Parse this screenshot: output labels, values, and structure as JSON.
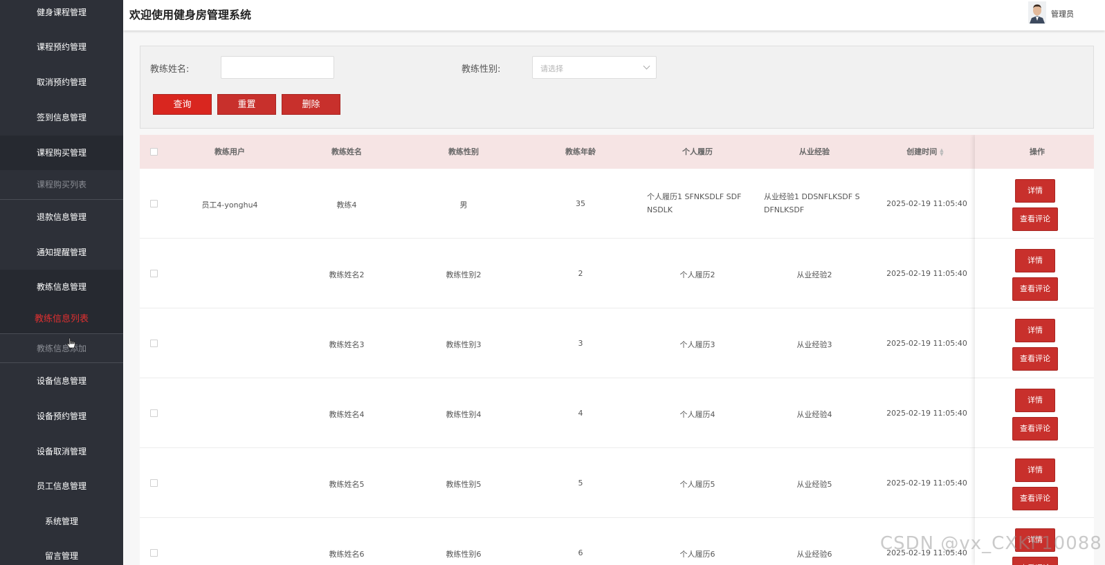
{
  "sidebar": {
    "items": [
      {
        "label": "健身课程管理"
      },
      {
        "label": "课程预约管理"
      },
      {
        "label": "取消预约管理"
      },
      {
        "label": "签到信息管理"
      },
      {
        "label": "课程购买管理"
      },
      {
        "label": "课程购买列表"
      },
      {
        "label": "退款信息管理"
      },
      {
        "label": "通知提醒管理"
      },
      {
        "label": "教练信息管理"
      },
      {
        "label": "教练信息列表"
      },
      {
        "label": "教练信息添加"
      },
      {
        "label": "设备信息管理"
      },
      {
        "label": "设备预约管理"
      },
      {
        "label": "设备取消管理"
      },
      {
        "label": "员工信息管理"
      },
      {
        "label": "系统管理"
      },
      {
        "label": "留言管理"
      }
    ]
  },
  "header": {
    "title": "欢迎使用健身房管理系统",
    "user": "管理员"
  },
  "search": {
    "name_label": "教练姓名:",
    "name_value": "",
    "gender_label": "教练性别:",
    "gender_placeholder": "请选择",
    "query_btn": "查询",
    "reset_btn": "重置",
    "delete_btn": "删除"
  },
  "table": {
    "columns": [
      "教练用户",
      "教练姓名",
      "教练性别",
      "教练年龄",
      "个人履历",
      "从业经验",
      "创建时间",
      "操作"
    ],
    "detail_label": "详情",
    "review_label": "查看评论",
    "rows": [
      {
        "user": "员工4-yonghu4",
        "name": "教练4",
        "gender": "男",
        "age": "35",
        "resume": "个人履历1 SFNKSDLF SDF NSDLK",
        "experience": "从业经验1 DDSNFLKSDF S DFNLKSDF",
        "created": "2025-02-19 11:05:40"
      },
      {
        "user": "",
        "name": "教练姓名2",
        "gender": "教练性别2",
        "age": "2",
        "resume": "个人履历2",
        "experience": "从业经验2",
        "created": "2025-02-19 11:05:40"
      },
      {
        "user": "",
        "name": "教练姓名3",
        "gender": "教练性别3",
        "age": "3",
        "resume": "个人履历3",
        "experience": "从业经验3",
        "created": "2025-02-19 11:05:40"
      },
      {
        "user": "",
        "name": "教练姓名4",
        "gender": "教练性别4",
        "age": "4",
        "resume": "个人履历4",
        "experience": "从业经验4",
        "created": "2025-02-19 11:05:40"
      },
      {
        "user": "",
        "name": "教练姓名5",
        "gender": "教练性别5",
        "age": "5",
        "resume": "个人履历5",
        "experience": "从业经验5",
        "created": "2025-02-19 11:05:40"
      },
      {
        "user": "",
        "name": "教练姓名6",
        "gender": "教练性别6",
        "age": "6",
        "resume": "个人履历6",
        "experience": "从业经验6",
        "created": "2025-02-19 11:05:40"
      }
    ]
  },
  "watermark": "CSDN @vx_CXKF10088",
  "colors": {
    "sidebar_bg": "#2d3038",
    "accent_red": "#c8302c",
    "active_menu": "#e03030",
    "table_header_bg": "#f6e4e4"
  }
}
